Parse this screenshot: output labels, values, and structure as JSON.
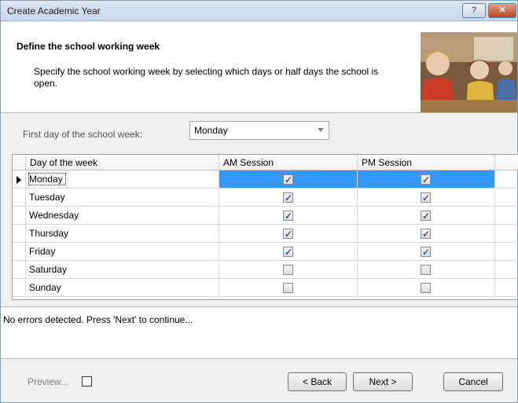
{
  "window": {
    "title": "Create Academic Year",
    "help_label": "?",
    "close_label": "✕"
  },
  "header": {
    "title": "Define the school working week",
    "description": "Specify the school working week by selecting which days or half days the school is open."
  },
  "first_day": {
    "label": "First day of the school week:",
    "value": "Monday"
  },
  "grid": {
    "columns": [
      "Day of the week",
      "AM Session",
      "PM Session"
    ],
    "rows": [
      {
        "day": "Monday",
        "am": true,
        "pm": true,
        "selected": true
      },
      {
        "day": "Tuesday",
        "am": true,
        "pm": true,
        "selected": false
      },
      {
        "day": "Wednesday",
        "am": true,
        "pm": true,
        "selected": false
      },
      {
        "day": "Thursday",
        "am": true,
        "pm": true,
        "selected": false
      },
      {
        "day": "Friday",
        "am": true,
        "pm": true,
        "selected": false
      },
      {
        "day": "Saturday",
        "am": false,
        "pm": false,
        "selected": false
      },
      {
        "day": "Sunday",
        "am": false,
        "pm": false,
        "selected": false
      }
    ]
  },
  "status": {
    "message": "No errors detected. Press 'Next' to continue..."
  },
  "footer": {
    "preview_label": "Preview...",
    "back_label": "< Back",
    "next_label": "Next >",
    "cancel_label": "Cancel"
  },
  "colors": {
    "selection": "#3399ff",
    "title_bar": "#c7d7ec",
    "close_button": "#c0392b"
  }
}
